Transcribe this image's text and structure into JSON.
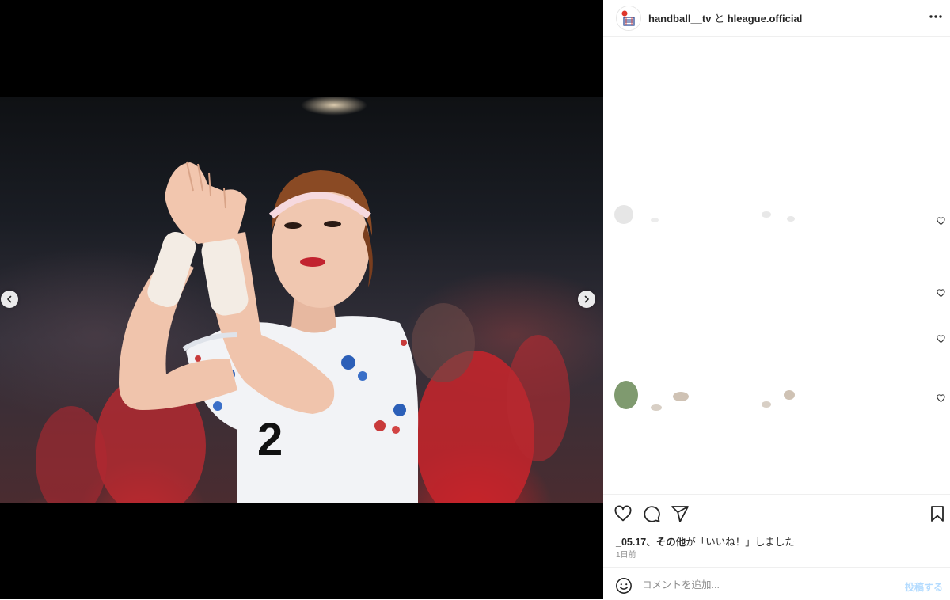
{
  "header": {
    "account_primary": "handball__tv",
    "connector": " と ",
    "account_secondary": "hleague.official",
    "avatar_icon": "team-logo-icon",
    "more_icon": "more-horizontal-icon"
  },
  "media": {
    "watermark": "",
    "prev_icon": "chevron-left-icon",
    "next_icon": "chevron-right-icon",
    "jersey_number": "2"
  },
  "actions": {
    "like_icon": "heart-outline-icon",
    "comment_icon": "comment-bubble-icon",
    "share_icon": "paper-plane-icon",
    "save_icon": "bookmark-icon"
  },
  "likes": {
    "user": "_05.17",
    "separator": "、",
    "others": "その他",
    "suffix": "が「いいね！」しました"
  },
  "timestamp": "1日前",
  "comment_bar": {
    "emoji_icon": "emoji-smile-icon",
    "placeholder": "コメントを追加...",
    "post_label": "投稿する"
  },
  "colors": {
    "text": "#262626",
    "muted": "#8e8e8e",
    "post_disabled": "#b3dbff",
    "divider": "#efefef"
  }
}
